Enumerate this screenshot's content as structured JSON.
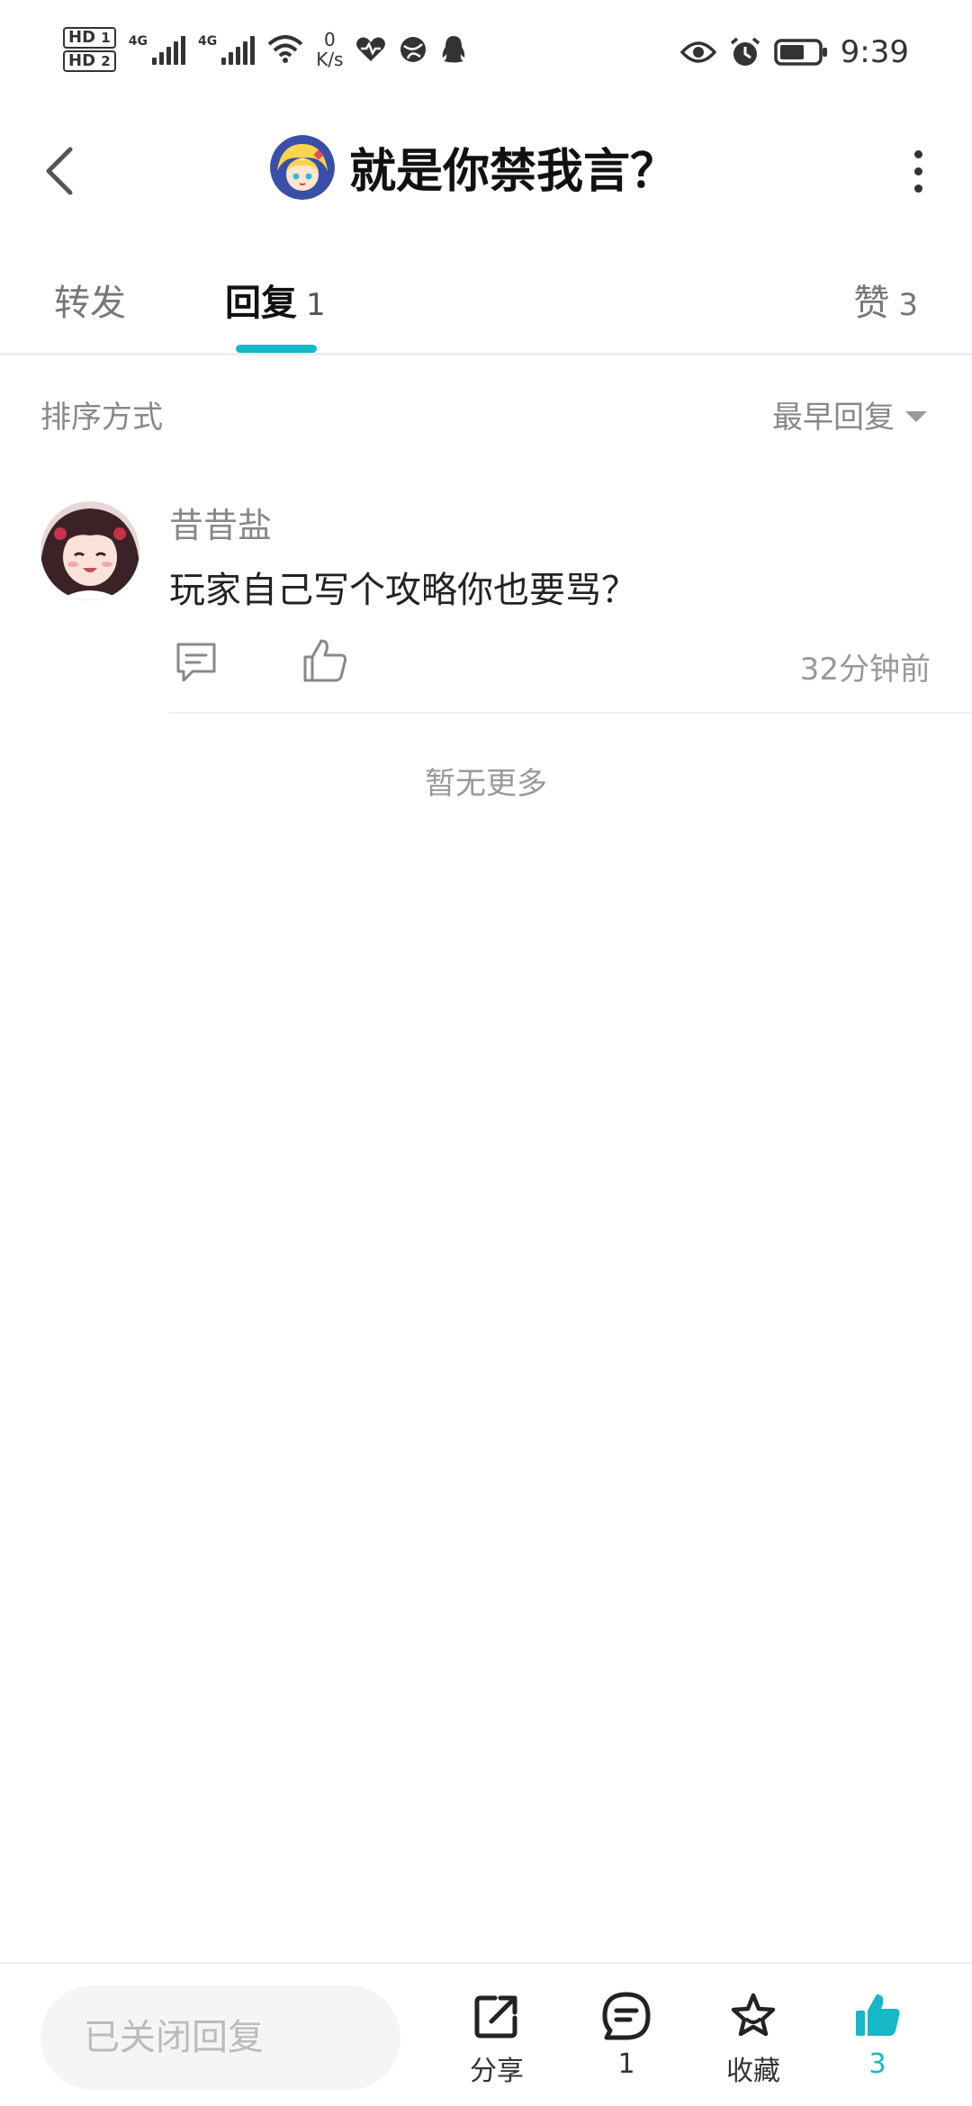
{
  "status_bar": {
    "hd1": "HD",
    "hd1_sub": "1",
    "hd2": "HD",
    "hd2_sub": "2",
    "net1": "4G",
    "net2": "4G",
    "speed_value": "0",
    "speed_unit": "K/s",
    "time": "9:39",
    "icons": [
      "health-icon",
      "browser-icon",
      "qq-icon",
      "eye-icon",
      "alarm-icon",
      "battery-icon"
    ]
  },
  "header": {
    "title": "就是你禁我言？"
  },
  "tabs": [
    {
      "label": "转发",
      "count": ""
    },
    {
      "label": "回复",
      "count": "1"
    },
    {
      "label": "赞",
      "count": "3"
    }
  ],
  "sort": {
    "label": "排序方式",
    "selected": "最早回复"
  },
  "replies": [
    {
      "name": "昔昔盐",
      "text": "玩家自己写个攻略你也要骂？",
      "time": "32分钟前"
    }
  ],
  "no_more": "暂无更多",
  "bottom_bar": {
    "input_placeholder": "已关闭回复",
    "share_label": "分享",
    "comment_count": "1",
    "favorite_label": "收藏",
    "like_count": "3",
    "accent_color": "#14b8c6"
  }
}
